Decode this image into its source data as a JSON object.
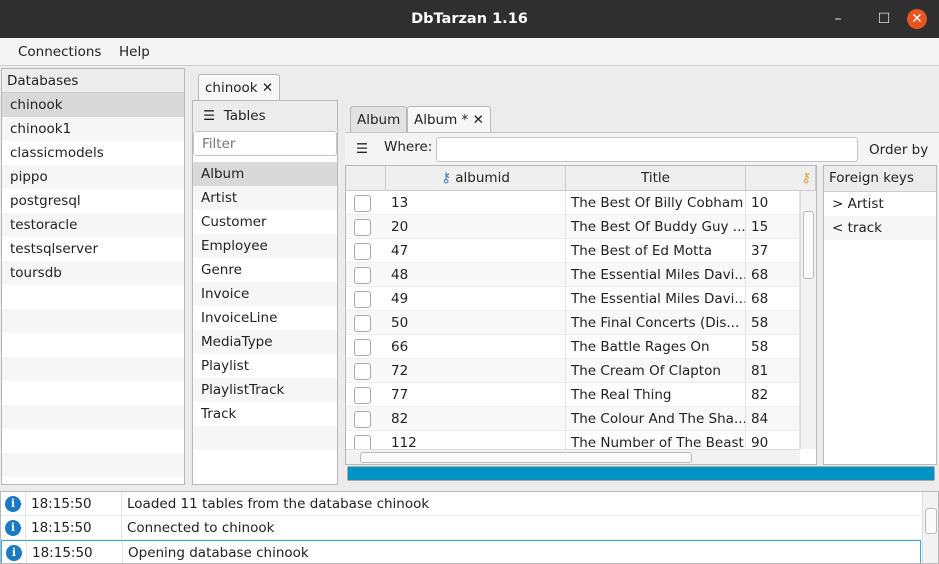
{
  "window": {
    "title": "DbTarzan 1.16",
    "close_color": "#e95420"
  },
  "menu": [
    "Connections",
    "Help"
  ],
  "databases": {
    "header": "Databases",
    "items": [
      "chinook",
      "chinook1",
      "classicmodels",
      "pippo",
      "postgresql",
      "testoracle",
      "testsqlserver",
      "toursdb"
    ],
    "selected": "chinook"
  },
  "db_tab": {
    "label": "chinook"
  },
  "tables": {
    "header": "Tables",
    "filter_placeholder": "Filter",
    "items": [
      "Album",
      "Artist",
      "Customer",
      "Employee",
      "Genre",
      "Invoice",
      "InvoiceLine",
      "MediaType",
      "Playlist",
      "PlaylistTrack",
      "Track"
    ],
    "selected": "Album"
  },
  "table_tabs": [
    {
      "label": "Album"
    },
    {
      "label": "Album *"
    }
  ],
  "query": {
    "where_label": "Where:",
    "where_value": "",
    "order_by_label": "Order by"
  },
  "grid": {
    "columns": [
      "albumid",
      "Title",
      ""
    ],
    "rows": [
      [
        "13",
        "The Best Of Billy Cobham",
        "10"
      ],
      [
        "20",
        "The Best Of Buddy Guy ...",
        "15"
      ],
      [
        "47",
        "The Best of Ed Motta",
        "37"
      ],
      [
        "48",
        "The Essential Miles Davi...",
        "68"
      ],
      [
        "49",
        "The Essential Miles Davi...",
        "68"
      ],
      [
        "50",
        "The Final Concerts (Dis...",
        "58"
      ],
      [
        "66",
        "The Battle Rages On",
        "58"
      ],
      [
        "72",
        "The Cream Of Clapton",
        "81"
      ],
      [
        "77",
        "The Real Thing",
        "82"
      ],
      [
        "82",
        "The Colour And The Sha...",
        "84"
      ],
      [
        "112",
        "The Number of The Beast",
        "90"
      ]
    ]
  },
  "foreign_keys": {
    "header": "Foreign keys",
    "items": [
      "> Artist",
      "< track"
    ]
  },
  "progress": {
    "value": 100,
    "color": "#0093c4"
  },
  "log": [
    {
      "time": "18:15:50",
      "message": "Loaded 11 tables from the database chinook"
    },
    {
      "time": "18:15:50",
      "message": "Connected to chinook"
    },
    {
      "time": "18:15:50",
      "message": "Opening database chinook"
    }
  ]
}
